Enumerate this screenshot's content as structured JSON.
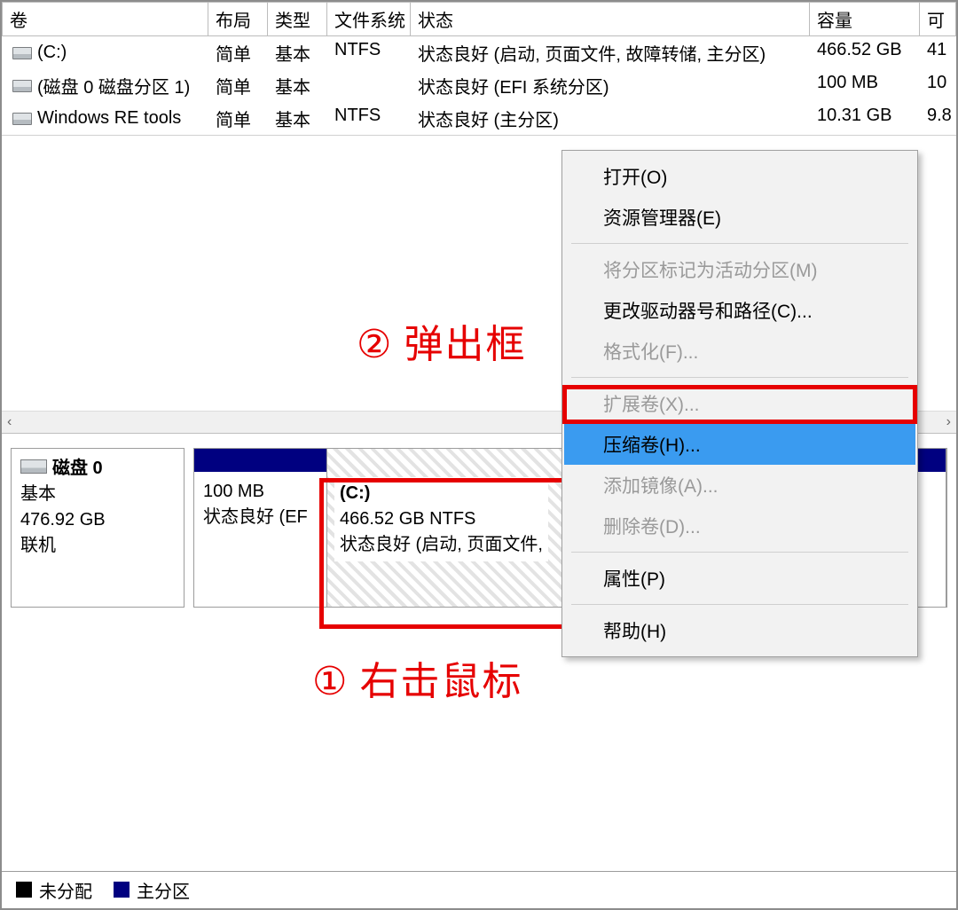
{
  "columns": {
    "vol": "卷",
    "layout": "布局",
    "type": "类型",
    "fs": "文件系统",
    "status": "状态",
    "cap": "容量",
    "free": "可"
  },
  "rows": [
    {
      "name": "(C:)",
      "layout": "简单",
      "type": "基本",
      "fs": "NTFS",
      "status": "状态良好 (启动, 页面文件, 故障转储, 主分区)",
      "cap": "466.52 GB",
      "free": "41"
    },
    {
      "name": "(磁盘 0 磁盘分区 1)",
      "layout": "简单",
      "type": "基本",
      "fs": "",
      "status": "状态良好 (EFI 系统分区)",
      "cap": "100 MB",
      "free": "10"
    },
    {
      "name": "Windows RE tools",
      "layout": "简单",
      "type": "基本",
      "fs": "NTFS",
      "status": "状态良好 (主分区)",
      "cap": "10.31 GB",
      "free": "9.8"
    }
  ],
  "disk": {
    "name": "磁盘 0",
    "type": "基本",
    "size": "476.92 GB",
    "state": "联机"
  },
  "parts": {
    "efi": {
      "size": "100 MB",
      "status": "状态良好 (EF"
    },
    "c": {
      "label": "(C:)",
      "line2": "466.52 GB NTFS",
      "line3": "状态良好 (启动, 页面文件,"
    }
  },
  "menu": {
    "open": "打开(O)",
    "explorer": "资源管理器(E)",
    "mark_active": "将分区标记为活动分区(M)",
    "change_letter": "更改驱动器号和路径(C)...",
    "format": "格式化(F)...",
    "extend": "扩展卷(X)...",
    "shrink": "压缩卷(H)...",
    "mirror": "添加镜像(A)...",
    "delete": "删除卷(D)...",
    "properties": "属性(P)",
    "help": "帮助(H)"
  },
  "anno": {
    "popup": "弹出框",
    "popup_num": "②",
    "rclick": "右击鼠标",
    "rclick_num": "①"
  },
  "legend": {
    "unalloc": "未分配",
    "primary": "主分区"
  },
  "scroll": {
    "left": "‹",
    "right": "›"
  }
}
